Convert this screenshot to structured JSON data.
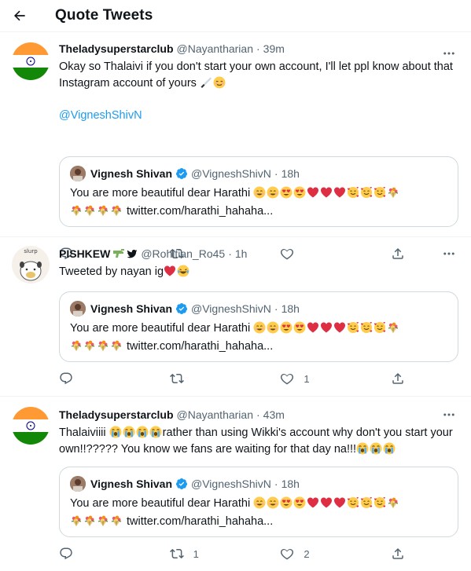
{
  "header": {
    "title": "Quote Tweets"
  },
  "quoted": {
    "name": "Vignesh Shivan",
    "handle": "@VigneshShivN",
    "time": "18h",
    "text": "You are more beautiful dear Harathi",
    "link": "twitter.com/harathi_hahaha..."
  },
  "tweets": [
    {
      "name": "Theladysuperstarclub",
      "handle": "@Nayantharian",
      "time": "39m",
      "text1": "Okay so Thalaivi if you don't start your own account, I'll let ppl know about that Instagram account of yours",
      "mention": "@VigneshShivN",
      "reply_count": "",
      "retweet_count": "",
      "like_count": ""
    },
    {
      "name": "PISHKEW",
      "handle": "@Rohitian_Ro45",
      "time": "1h",
      "text1": "Tweeted by nayan ig",
      "avatar_text": "slurp",
      "reply_count": "",
      "retweet_count": "",
      "like_count": "1"
    },
    {
      "name": "Theladysuperstarclub",
      "handle": "@Nayantharian",
      "time": "43m",
      "text1": "Thalaiviiii",
      "text2": "rather than using Wikki's account why don't you start your own!!????? You know we fans are waiting for that day na!!!",
      "reply_count": "",
      "retweet_count": "1",
      "like_count": "2"
    }
  ],
  "icons": {
    "back": "arrow-left-icon",
    "more": "more-dots-icon",
    "reply": "reply-icon",
    "retweet": "retweet-icon",
    "like": "heart-icon",
    "share": "share-icon",
    "verified": "verified-badge-icon"
  },
  "colors": {
    "accent": "#1d9bf0",
    "secondary_text": "#536471",
    "border": "#cfd9de"
  }
}
